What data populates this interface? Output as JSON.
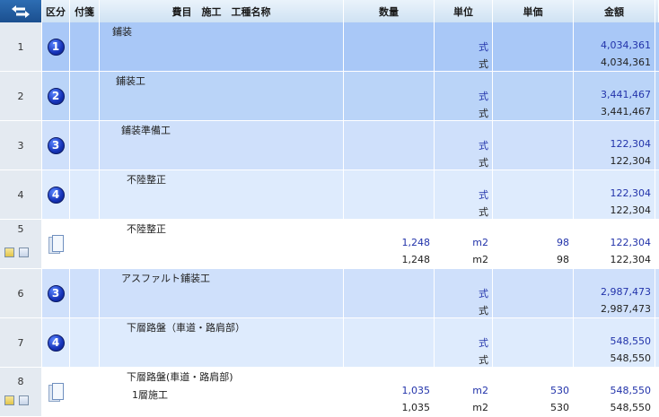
{
  "header": {
    "col_swap": "",
    "col_kubun": "区分",
    "col_fusen": "付箋",
    "col_name": "費目　施工　工種名称",
    "col_qty": "数量",
    "col_unit": "単位",
    "col_price": "単価",
    "col_amount": "金額"
  },
  "rows": [
    {
      "num": "1",
      "badge": "1",
      "name": "鋪装",
      "name2": "",
      "qty_a": "",
      "qty_b": "",
      "unit_a": "式",
      "unit_b": "式",
      "price_a": "",
      "price_b": "",
      "amount_a": "4,034,361",
      "amount_b": "4,034,361"
    },
    {
      "num": "2",
      "badge": "2",
      "name": "鋪装工",
      "name2": "",
      "qty_a": "",
      "qty_b": "",
      "unit_a": "式",
      "unit_b": "式",
      "price_a": "",
      "price_b": "",
      "amount_a": "3,441,467",
      "amount_b": "3,441,467"
    },
    {
      "num": "3",
      "badge": "3",
      "name": "鋪装準備工",
      "name2": "",
      "qty_a": "",
      "qty_b": "",
      "unit_a": "式",
      "unit_b": "式",
      "price_a": "",
      "price_b": "",
      "amount_a": "122,304",
      "amount_b": "122,304"
    },
    {
      "num": "4",
      "badge": "4",
      "name": "不陸整正",
      "name2": "",
      "qty_a": "",
      "qty_b": "",
      "unit_a": "式",
      "unit_b": "式",
      "price_a": "",
      "price_b": "",
      "amount_a": "122,304",
      "amount_b": "122,304"
    },
    {
      "num": "5",
      "badge": "",
      "name": "不陸整正",
      "name2": "",
      "qty_a": "1,248",
      "qty_b": "1,248",
      "unit_a": "m2",
      "unit_b": "m2",
      "price_a": "98",
      "price_b": "98",
      "amount_a": "122,304",
      "amount_b": "122,304"
    },
    {
      "num": "6",
      "badge": "3",
      "name": "アスファルト鋪装工",
      "name2": "",
      "qty_a": "",
      "qty_b": "",
      "unit_a": "式",
      "unit_b": "式",
      "price_a": "",
      "price_b": "",
      "amount_a": "2,987,473",
      "amount_b": "2,987,473"
    },
    {
      "num": "7",
      "badge": "4",
      "name": "下層路盤（車道・路肩部）",
      "name2": "",
      "qty_a": "",
      "qty_b": "",
      "unit_a": "式",
      "unit_b": "式",
      "price_a": "",
      "price_b": "",
      "amount_a": "548,550",
      "amount_b": "548,550"
    },
    {
      "num": "8",
      "badge": "",
      "name": "下層路盤(車道・路肩部)",
      "name2": "1層施工",
      "qty_a": "1,035",
      "qty_b": "1,035",
      "unit_a": "m2",
      "unit_b": "m2",
      "price_a": "530",
      "price_b": "530",
      "amount_a": "548,550",
      "amount_b": "548,550"
    }
  ],
  "colors": {
    "level1": "#a9c8f7",
    "level2": "#bad4f8",
    "level3": "#cfe0fb",
    "level4": "#deebfd",
    "detail": "#ffffff",
    "row_number_bg": "#e4eaf1",
    "value_blue": "#2233aa"
  }
}
